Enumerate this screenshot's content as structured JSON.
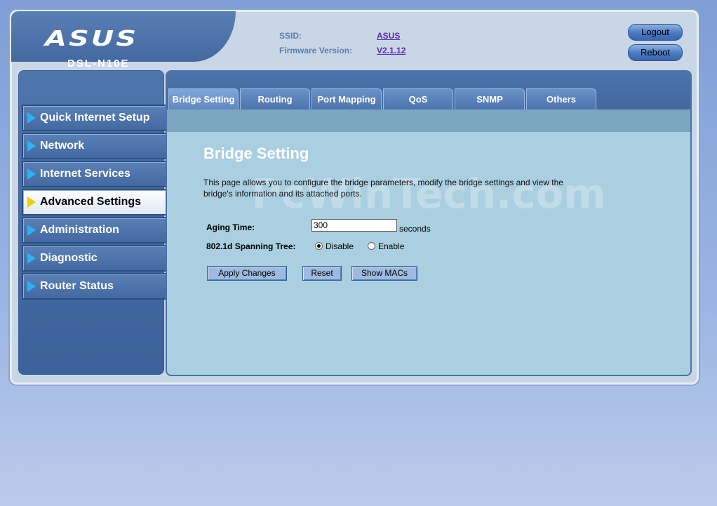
{
  "header": {
    "brand": "ASUS",
    "model": "DSL-N10E",
    "ssid_label": "SSID:",
    "ssid_value": "ASUS",
    "firmware_label": "Firmware Version:",
    "firmware_value": "V2.1.12",
    "logout_label": "Logout",
    "reboot_label": "Reboot"
  },
  "sidebar": {
    "items": [
      {
        "label": "Quick Internet Setup"
      },
      {
        "label": "Network"
      },
      {
        "label": "Internet Services"
      },
      {
        "label": "Advanced Settings",
        "active": true
      },
      {
        "label": "Administration"
      },
      {
        "label": "Diagnostic"
      },
      {
        "label": "Router Status"
      }
    ]
  },
  "tabs": [
    {
      "label": "Bridge Setting",
      "active": true
    },
    {
      "label": "Routing"
    },
    {
      "label": "Port Mapping"
    },
    {
      "label": "QoS"
    },
    {
      "label": "SNMP"
    },
    {
      "label": "Others"
    }
  ],
  "main": {
    "title": "Bridge Setting",
    "description": "This page allows you to configure the bridge parameters, modify the bridge settings and view the bridge's information and its attached ports.",
    "watermark": "PcWinTech.com",
    "aging_label": "Aging Time:",
    "aging_value": "300",
    "aging_unit": "seconds",
    "stp_label": "802.1d Spanning Tree:",
    "stp_options": [
      {
        "label": "Disable",
        "selected": true
      },
      {
        "label": "Enable",
        "selected": false
      }
    ],
    "apply_label": "Apply Changes",
    "reset_label": "Reset",
    "showmacs_label": "Show MACs"
  }
}
